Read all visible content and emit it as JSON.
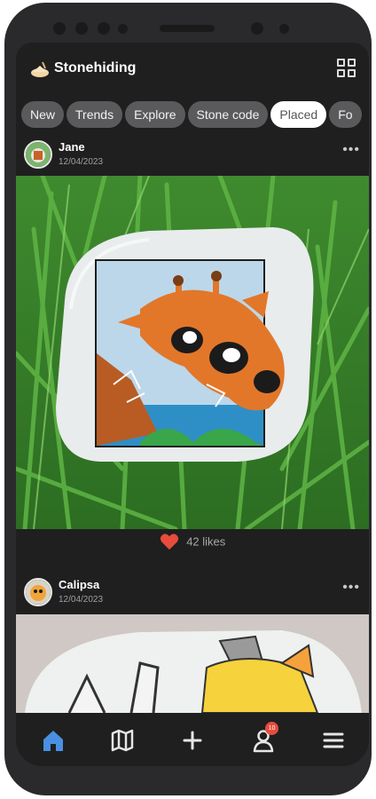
{
  "app": {
    "title": "Stonehiding"
  },
  "tabs": [
    {
      "label": "New",
      "active": false
    },
    {
      "label": "Trends",
      "active": false
    },
    {
      "label": "Explore",
      "active": false
    },
    {
      "label": "Stone code",
      "active": false
    },
    {
      "label": "Placed",
      "active": true
    },
    {
      "label": "Fo",
      "active": false
    }
  ],
  "posts": [
    {
      "user": "Jane",
      "date": "12/04/2023",
      "likes": "42 likes",
      "image": "painted stone with giraffe on grass"
    },
    {
      "user": "Calipsa",
      "date": "12/04/2023"
    }
  ],
  "nav": {
    "items": [
      "home-icon",
      "map-icon",
      "add-icon",
      "profile-icon",
      "menu-icon"
    ],
    "badge": "10"
  },
  "colors": {
    "accent": "#4a90e2",
    "heart": "#e74c3c",
    "background": "#1f1f1f"
  }
}
